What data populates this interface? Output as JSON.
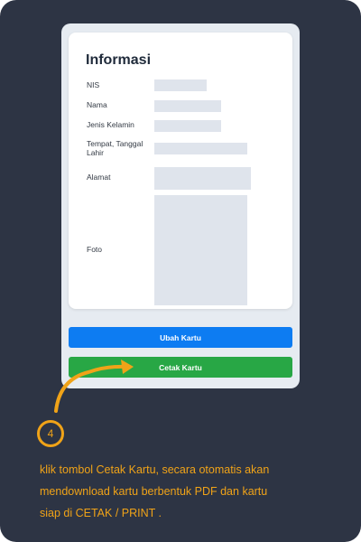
{
  "form": {
    "title": "Informasi",
    "fields": [
      {
        "label": "NIS"
      },
      {
        "label": "Nama"
      },
      {
        "label": "Jenis Kelamin"
      },
      {
        "label": "Tempat, Tanggal Lahir"
      },
      {
        "label": "Alamat"
      },
      {
        "label": "Foto"
      }
    ]
  },
  "buttons": {
    "edit_label": "Ubah Kartu",
    "print_label": "Cetak Kartu"
  },
  "tutorial": {
    "step_number": "4",
    "lines": [
      "klik tombol Cetak Kartu, secara otomatis akan",
      "mendownload kartu berbentuk PDF dan kartu",
      "siap di CETAK / PRINT ."
    ]
  },
  "colors": {
    "background": "#2d3444",
    "accent": "#f0a318",
    "edit_button": "#0d7cf2",
    "print_button": "#28a745",
    "placeholder": "#dfe4ec"
  }
}
